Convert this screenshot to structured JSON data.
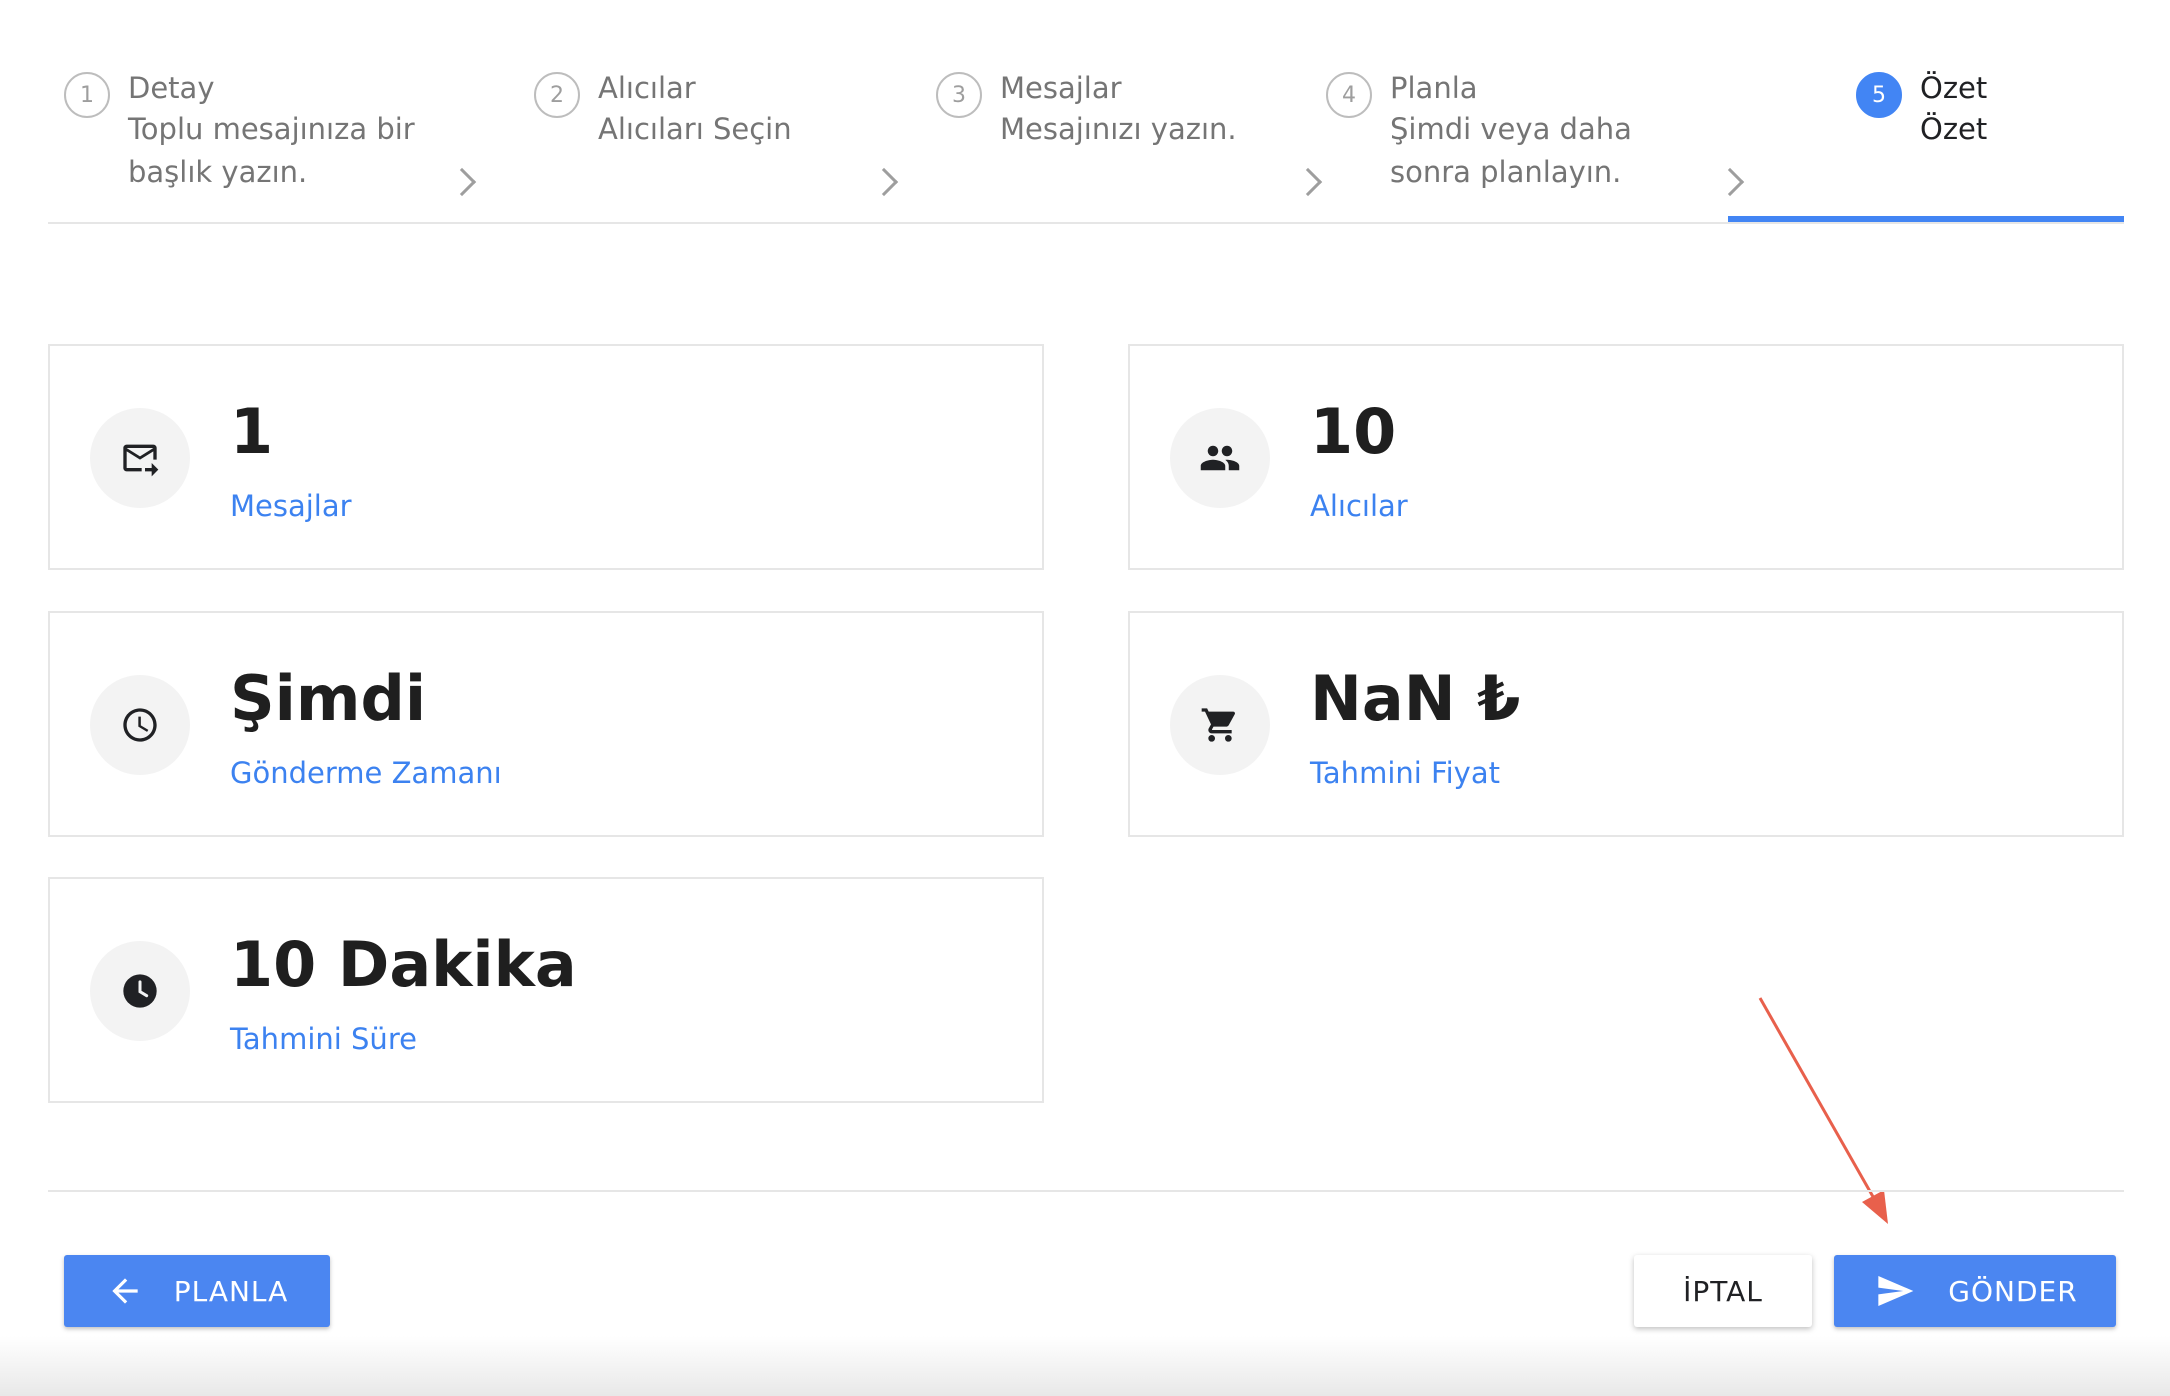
{
  "stepper": {
    "steps": [
      {
        "num": "1",
        "title": "Detay",
        "subtitle_line1": "Toplu mesajınıza bir",
        "subtitle_line2": "başlık yazın."
      },
      {
        "num": "2",
        "title": "Alıcılar",
        "subtitle_line1": "Alıcıları Seçin",
        "subtitle_line2": ""
      },
      {
        "num": "3",
        "title": "Mesajlar",
        "subtitle_line1": "Mesajınızı yazın.",
        "subtitle_line2": ""
      },
      {
        "num": "4",
        "title": "Planla",
        "subtitle_line1": "Şimdi veya daha",
        "subtitle_line2": "sonra planlayın."
      },
      {
        "num": "5",
        "title": "Özet",
        "subtitle_line1": "Özet",
        "subtitle_line2": ""
      }
    ],
    "active_step": 5
  },
  "cards": {
    "messages": {
      "value": "1",
      "label": "Mesajlar",
      "icon": "forward-to-inbox-icon"
    },
    "recipients": {
      "value": "10",
      "label": "Alıcılar",
      "icon": "people-icon"
    },
    "send_time": {
      "value": "Şimdi",
      "label": "Gönderme Zamanı",
      "icon": "clock-outline-icon"
    },
    "estimated_price": {
      "value": "NaN ₺",
      "label": "Tahmini Fiyat",
      "icon": "shopping-cart-icon"
    },
    "estimated_duration": {
      "value": "10 Dakika",
      "label": "Tahmini Süre",
      "icon": "clock-filled-icon"
    }
  },
  "actions": {
    "back_label": "PLANLA",
    "cancel_label": "İPTAL",
    "send_label": "GÖNDER"
  },
  "colors": {
    "accent": "#4285f4",
    "label_blue": "#3c82f0",
    "annotation_arrow": "#e8604c"
  }
}
